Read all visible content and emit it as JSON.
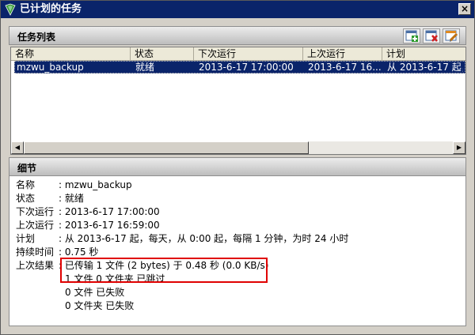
{
  "window": {
    "title": "已计划的任务",
    "close_glyph": "×"
  },
  "task_panel": {
    "label": "任务列表"
  },
  "toolbar": {
    "icons": [
      "calendar-add-icon",
      "calendar-delete-icon",
      "calendar-edit-icon"
    ]
  },
  "columns": [
    "名称",
    "状态",
    "下次运行",
    "上次运行",
    "计划"
  ],
  "selected_row": {
    "name": "mzwu_backup",
    "status": "就绪",
    "next_run": "2013-6-17 17:00:00",
    "last_run": "2013-6-17 16...",
    "schedule": "从 2013-6-17 起，"
  },
  "details_panel": {
    "label": "细节"
  },
  "details": {
    "name_label": "名称",
    "name_value": ": mzwu_backup",
    "status_label": "状态",
    "status_value": ": 就绪",
    "next_label": "下次运行",
    "next_value": ": 2013-6-17 17:00:00",
    "last_label": "上次运行",
    "last_value": ": 2013-6-17 16:59:00",
    "plan_label": "计划",
    "plan_value": ": 从 2013-6-17 起，每天，从 0:00 起，每隔 1 分钟，为时 24 小时",
    "duration_label": "持续时间",
    "duration_value": ": 0.75 秒",
    "result_label": "上次结果",
    "result_lines": [
      ": 已传输 1 文件 (2 bytes) 于 0.48 秒 (0.0 KB/s)",
      "1 文件 0 文件夹 已跳过",
      "0 文件 已失败",
      "0 文件夹 已失败"
    ]
  },
  "colors": {
    "titlebar": "#0a246a",
    "selection": "#0a246a",
    "highlight_border": "#e00000"
  }
}
